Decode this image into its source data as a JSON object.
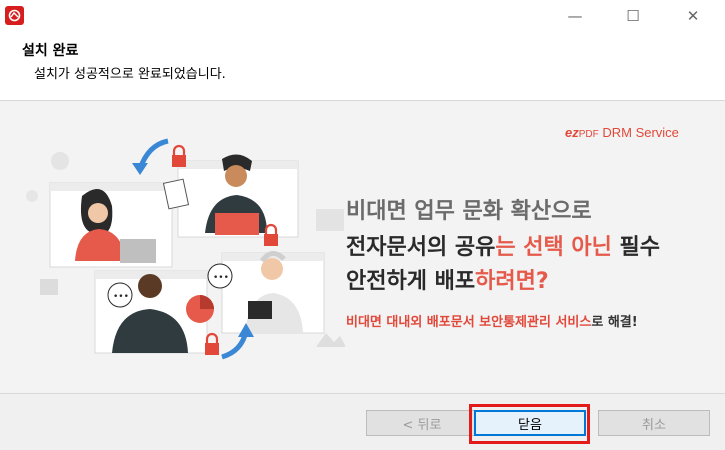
{
  "window": {
    "title": "",
    "minimize": "—",
    "maximize": "☐",
    "close": "✕"
  },
  "header": {
    "title": "설치 완료",
    "subtitle": "설치가 성공적으로 완료되었습니다."
  },
  "banner": {
    "brand_prefix": "ez",
    "brand_pdf": "PDF",
    "brand_name": " DRM Service",
    "line1": "비대면 업무 문화 확산으로",
    "line2_a": "전자문서의 공유",
    "line2_b": "는 선택 아닌 ",
    "line2_c": "필수",
    "line3_a": "안전하게 배포",
    "line3_b": "하려면?",
    "sub_a": "비대면 대내외 배포문서 보안통제관리 서비스",
    "sub_b": "로 해결!"
  },
  "buttons": {
    "back": "< 뒤로",
    "close": "닫음",
    "cancel": "취소"
  }
}
